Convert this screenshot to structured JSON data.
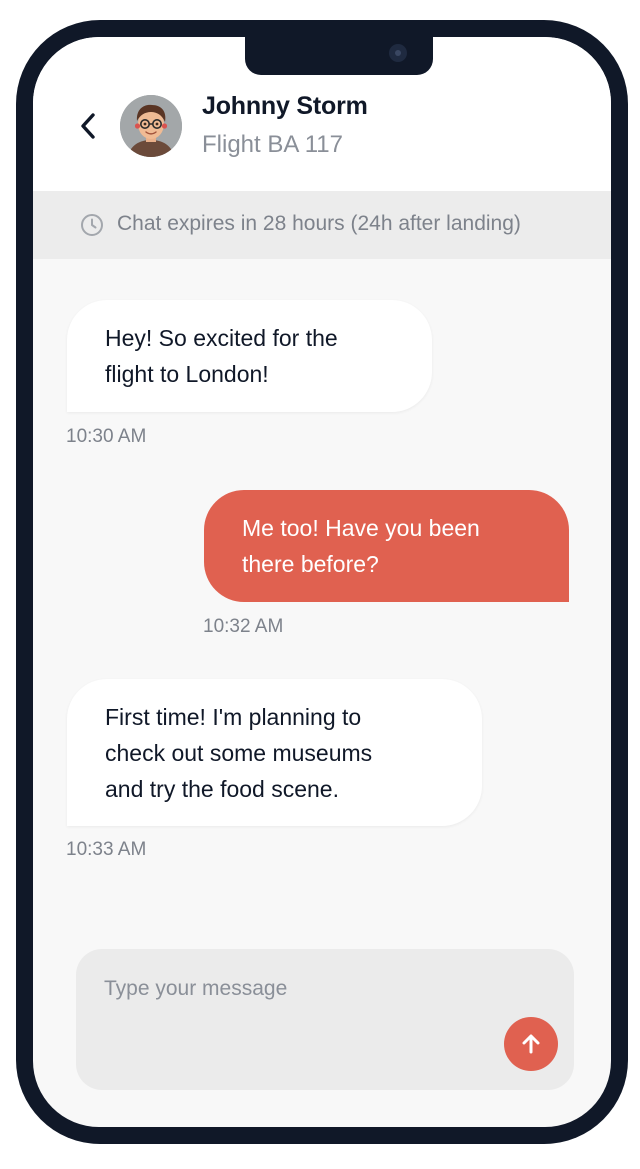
{
  "header": {
    "contact_name": "Johnny Storm",
    "subtitle": "Flight BA 117",
    "back_icon": "chevron-left-icon",
    "avatar": "avatar-icon"
  },
  "banner": {
    "icon": "clock-icon",
    "text": "Chat expires in 28 hours (24h after landing)"
  },
  "messages": [
    {
      "direction": "incoming",
      "lines": [
        "Hey! So excited for the",
        "flight to London!"
      ],
      "time": "10:30 AM"
    },
    {
      "direction": "outgoing",
      "lines": [
        "Me too! Have you been",
        "there before?"
      ],
      "time": "10:32 AM"
    },
    {
      "direction": "incoming",
      "lines": [
        "First time! I'm planning to",
        "check out some museums",
        "and try the food scene."
      ],
      "time": "10:33 AM"
    }
  ],
  "composer": {
    "placeholder": "Type your message",
    "value": "",
    "send_icon": "arrow-up-icon"
  },
  "colors": {
    "accent": "#e06150",
    "frame": "#101828",
    "background": "#f8f8f8",
    "banner": "#ececec",
    "muted_text": "#7d828b"
  }
}
